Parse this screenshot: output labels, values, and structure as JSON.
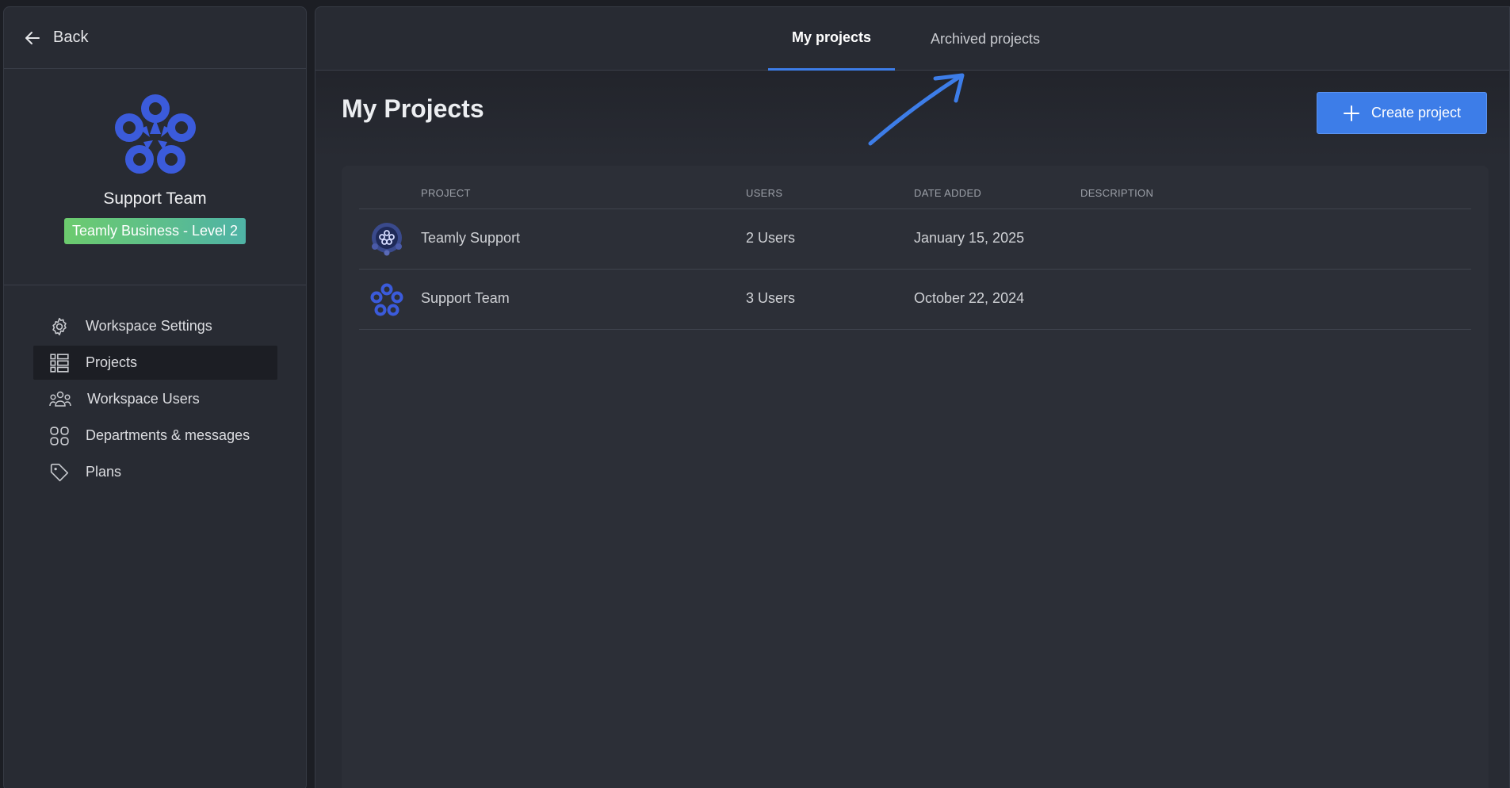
{
  "sidebar": {
    "back_label": "Back",
    "workspace_name": "Support Team",
    "plan_badge": "Teamly Business - Level 2",
    "items": [
      {
        "label": "Workspace Settings",
        "icon": "gear-icon",
        "active": false
      },
      {
        "label": "Projects",
        "icon": "projects-list-icon",
        "active": true
      },
      {
        "label": "Workspace Users",
        "icon": "users-icon",
        "active": false
      },
      {
        "label": "Departments & messages",
        "icon": "grid-icon",
        "active": false
      },
      {
        "label": "Plans",
        "icon": "tag-icon",
        "active": false
      }
    ]
  },
  "tabs": {
    "my_projects": "My projects",
    "archived_projects": "Archived projects"
  },
  "main": {
    "title": "My Projects",
    "create_button": "Create project"
  },
  "table": {
    "columns": [
      "PROJECT",
      "USERS",
      "DATE ADDED",
      "DESCRIPTION"
    ],
    "rows": [
      {
        "project": "Teamly Support",
        "users": "2 Users",
        "date": "January 15, 2025",
        "description": "",
        "avatar": "teamly-support-avatar"
      },
      {
        "project": "Support Team",
        "users": "3 Users",
        "date": "October 22, 2024",
        "description": "",
        "avatar": "support-team-logo"
      }
    ]
  },
  "colors": {
    "accent": "#3d7de8",
    "logo_blue": "#3b5bdb",
    "background": "#282b33"
  }
}
